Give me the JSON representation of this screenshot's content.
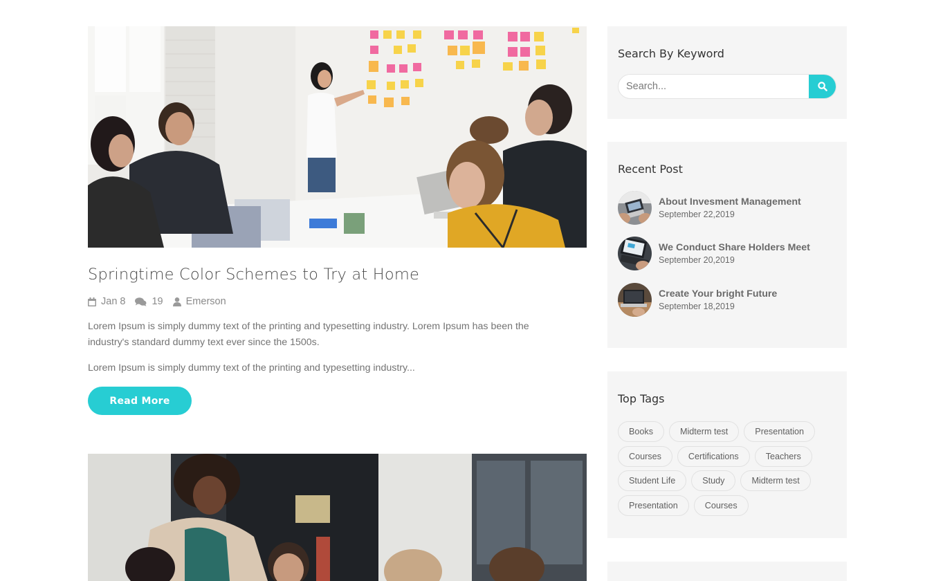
{
  "post": {
    "title": "Springtime Color Schemes to Try at Home",
    "meta": {
      "date": "Jan 8",
      "comments": "19",
      "author": "Emerson"
    },
    "excerpt_1": "Lorem Ipsum is simply dummy text of the printing and typesetting industry. Lorem Ipsum has been the industry's standard dummy text ever since the 1500s.",
    "excerpt_2": "Lorem Ipsum is simply dummy text of the printing and typesetting industry...",
    "read_more_label": "Read More"
  },
  "sidebar": {
    "search": {
      "title": "Search By Keyword",
      "placeholder": "Search...",
      "icon": "search-icon"
    },
    "recent": {
      "title": "Recent Post",
      "items": [
        {
          "title": "About Invesment Management",
          "date": "September 22,2019"
        },
        {
          "title": "We Conduct Share Holders Meet",
          "date": "September 20,2019"
        },
        {
          "title": "Create Your bright Future",
          "date": "September 18,2019"
        }
      ]
    },
    "tags": {
      "title": "Top Tags",
      "items": [
        "Books",
        "Midterm test",
        "Presentation",
        "Courses",
        "Certifications",
        "Teachers",
        "Student Life",
        "Study",
        "Midterm test",
        "Presentation",
        "Courses"
      ]
    }
  },
  "colors": {
    "accent": "#27cdd3",
    "widget_bg": "#f5f5f5",
    "heading": "#4a4a4a",
    "body_text": "#737373"
  },
  "icons": {
    "date": "calendar-icon",
    "comments": "comments-icon",
    "author": "user-icon"
  }
}
